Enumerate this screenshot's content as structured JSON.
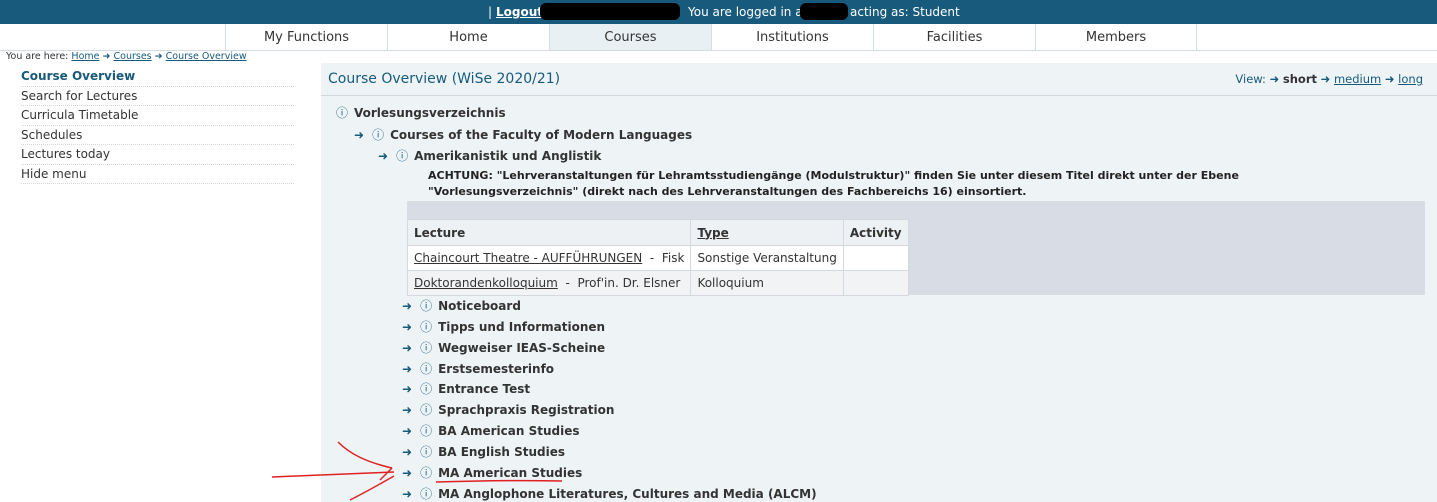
{
  "topbar": {
    "separator": "|",
    "logout": "Logout",
    "logged_in_as": "You are logged in as:",
    "acting_as": "acting as: Student"
  },
  "nav": [
    {
      "label": "My Functions",
      "active": false
    },
    {
      "label": "Home",
      "active": false
    },
    {
      "label": "Courses",
      "active": true
    },
    {
      "label": "Institutions",
      "active": false
    },
    {
      "label": "Facilities",
      "active": false
    },
    {
      "label": "Members",
      "active": false
    }
  ],
  "breadcrumb": {
    "prefix": "You are here:",
    "items": [
      "Home",
      "Courses",
      "Course Overview"
    ]
  },
  "sidebar": {
    "items": [
      {
        "label": "Course Overview",
        "active": true
      },
      {
        "label": "Search for Lectures",
        "active": false
      },
      {
        "label": "Curricula Timetable",
        "active": false
      },
      {
        "label": "Schedules",
        "active": false
      },
      {
        "label": "Lectures today",
        "active": false
      },
      {
        "label": "Hide menu",
        "active": false
      }
    ]
  },
  "main": {
    "title": "Course Overview (WiSe 2020/21)",
    "view": {
      "label": "View:",
      "options": [
        "short",
        "medium",
        "long"
      ],
      "selected": "short"
    }
  },
  "tree": {
    "root": "Vorlesungsverzeichnis",
    "faculty": "Courses of the Faculty of Modern Languages",
    "department": "Amerikanistik und Anglistik",
    "notice": "ACHTUNG: \"Lehrveranstaltungen für Lehramtsstudiengänge (Modulstruktur)\" finden Sie unter diesem Titel direkt unter der Ebene \"Vorlesungsverzeichnis\" (direkt nach des Lehrveranstaltungen des Fachbereichs 16) einsortiert.",
    "children": [
      "Noticeboard",
      "Tipps und Informationen",
      "Wegweiser IEAS-Scheine",
      "Erstsemesterinfo",
      "Entrance Test",
      "Sprachpraxis Registration",
      "BA American Studies",
      "BA English Studies",
      "MA American Studies",
      "MA Anglophone Literatures, Cultures and Media (ALCM)"
    ]
  },
  "lectures_table": {
    "headers": [
      "Lecture",
      "Type",
      "Activity"
    ],
    "rows": [
      {
        "title": "Chaincourt Theatre - AUFFÜHRUNGEN",
        "sep": "-",
        "person": "Fisk",
        "type": "Sonstige Veranstaltung",
        "activity": ""
      },
      {
        "title": "Doktorandenkolloquium",
        "sep": "-",
        "person": "Prof'in. Dr. Elsner",
        "type": "Kolloquium",
        "activity": ""
      }
    ]
  },
  "icons": {
    "arrow": "arrow-right-icon",
    "info": "info-circle-icon"
  },
  "colors": {
    "brand": "#175a7c",
    "annotation": "#e02020"
  }
}
